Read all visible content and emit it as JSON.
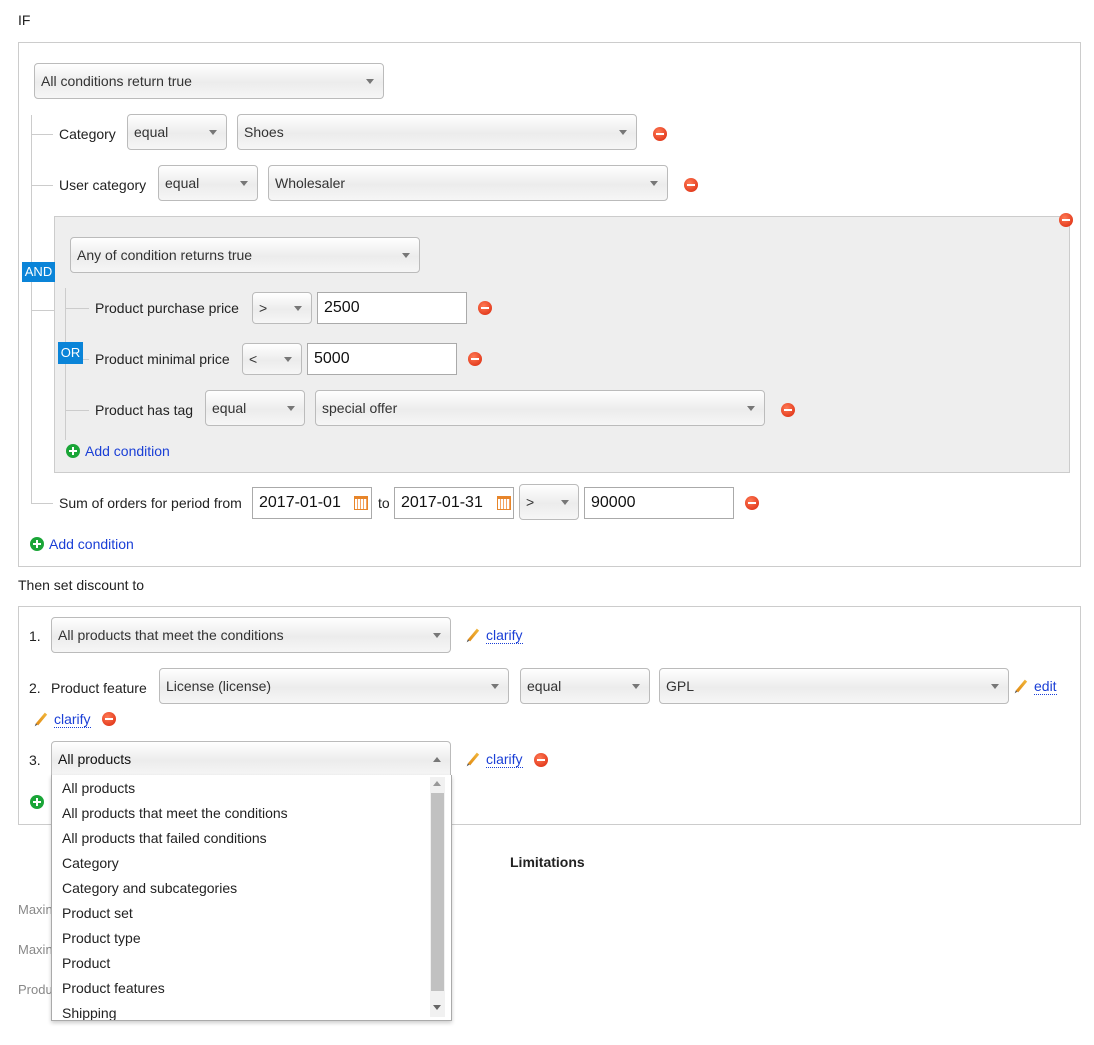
{
  "if_label": "IF",
  "root_mode": "All conditions return true",
  "and_badge": "AND",
  "or_badge": "OR",
  "conditions": [
    {
      "label": "Category",
      "op": "equal",
      "value": "Shoes"
    },
    {
      "label": "User category",
      "op": "equal",
      "value": "Wholesaler"
    }
  ],
  "group": {
    "mode": "Any of condition returns true",
    "rows": [
      {
        "label": "Product purchase price",
        "op": ">",
        "value": "2500"
      },
      {
        "label": "Product minimal price",
        "op": "<",
        "value": "5000"
      },
      {
        "label": "Product has tag",
        "op": "equal",
        "value": "special offer"
      }
    ],
    "add_condition": "Add condition"
  },
  "sum_row": {
    "label": "Sum of orders for period from",
    "from": "2017-01-01",
    "to_label": "to",
    "to": "2017-01-31",
    "op": ">",
    "value": "90000"
  },
  "add_condition": "Add condition",
  "then_label": "Then set discount to",
  "discount_rows": [
    {
      "num": "1.",
      "select": "All products that meet the conditions",
      "clarify": "clarify"
    },
    {
      "num": "2.",
      "label": "Product feature",
      "feature": "License (license)",
      "op": "equal",
      "value": "GPL",
      "edit": "edit",
      "clarify": "clarify"
    },
    {
      "num": "3.",
      "select": "All products",
      "clarify": "clarify"
    }
  ],
  "dropdown_options": [
    "All products",
    "All products that meet the conditions",
    "All products that failed conditions",
    "Category",
    "Category and subcategories",
    "Product set",
    "Product type",
    "Product",
    "Product features",
    "Shipping"
  ],
  "limitations": "Limitations",
  "partial_labels": [
    "Maxin",
    "Maxin",
    "Produ"
  ]
}
